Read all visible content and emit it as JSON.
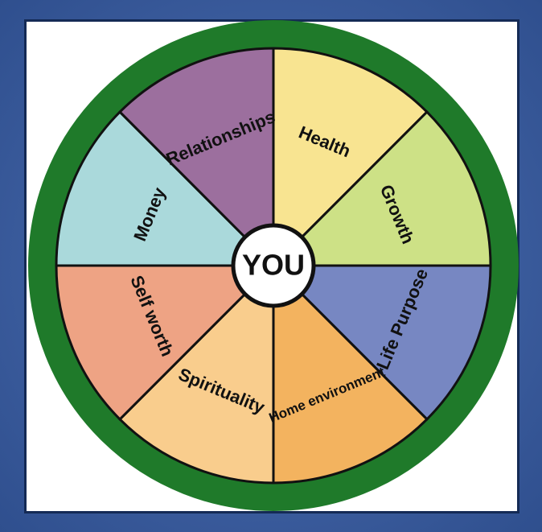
{
  "center": {
    "label": "YOU"
  },
  "segments": [
    {
      "label": "Health",
      "color": "#f8e491"
    },
    {
      "label": "Growth",
      "color": "#cde186"
    },
    {
      "label": "Life Purpose",
      "color": "#7787c2"
    },
    {
      "label": "Home environment",
      "color": "#f3b35f"
    },
    {
      "label": "Spirituality",
      "color": "#f9cd8d"
    },
    {
      "label": "Self worth",
      "color": "#eea384"
    },
    {
      "label": "Money",
      "color": "#aad9db"
    },
    {
      "label": "Relationships",
      "color": "#9c6f9e"
    }
  ],
  "colors": {
    "rim": "#1f7a2a",
    "background": "#3f5f9f",
    "panel": "#ffffff"
  }
}
